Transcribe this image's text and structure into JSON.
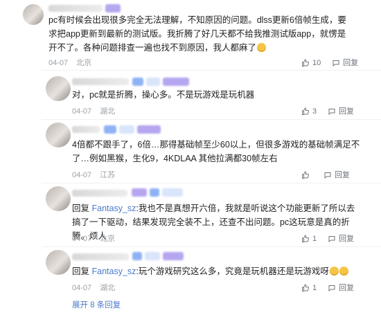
{
  "comments": [
    {
      "text": "pc有时候会出现很多完全无法理解，不知原因的问题。dlss更新6倍帧生成，要求把app更新到最新的测试版。我折腾了好几天都不给我推测试版app，就愣是开不了。各种问题排查一遍也找不到原因，我人都麻了",
      "date": "04-07",
      "location": "北京",
      "likes": "10",
      "reply": "回复"
    },
    {
      "text": "对，pc就是折腾，操心多。不是玩游戏是玩机器",
      "date": "04-07",
      "location": "湖北",
      "likes": "3",
      "reply": "回复"
    },
    {
      "text": "4倍都不跟手了，6倍…那得基础帧至少60以上，但很多游戏的基础帧满足不了…例如黑猴，生化9，4KDLAA 其他拉满都30帧左右",
      "date": "04-07",
      "location": "江苏",
      "likes": "",
      "reply": "回复"
    },
    {
      "reply_prefix": "回复 ",
      "mention": "Fantasy_sz",
      "text": ":我也不是真想开六倍，我就是听说这个功能更新了所以去搞了一下驱动，结果发现完全装不上，还查不出问题。pc这玩意是真的折腾。烦人",
      "date": "04-07",
      "location": "北京",
      "likes": "1",
      "reply": "回复"
    },
    {
      "reply_prefix": "回复 ",
      "mention": "Fantasy_sz",
      "text": ":玩个游戏研究这么多，究竟是玩机器还是玩游戏呀",
      "date": "04-07",
      "location": "湖北",
      "likes": "1",
      "reply": "回复"
    }
  ],
  "usernames": [
    "Fantasy_sz"
  ],
  "expand_replies": "展开 8 条回复",
  "colors": {
    "accent": "#4b79c9",
    "meta": "#9aa0a6",
    "action": "#6d737b"
  },
  "icons": {
    "like": "thumbs-up-icon",
    "reply": "comment-bubble-icon",
    "emoji": "grinning-face-emoji"
  }
}
